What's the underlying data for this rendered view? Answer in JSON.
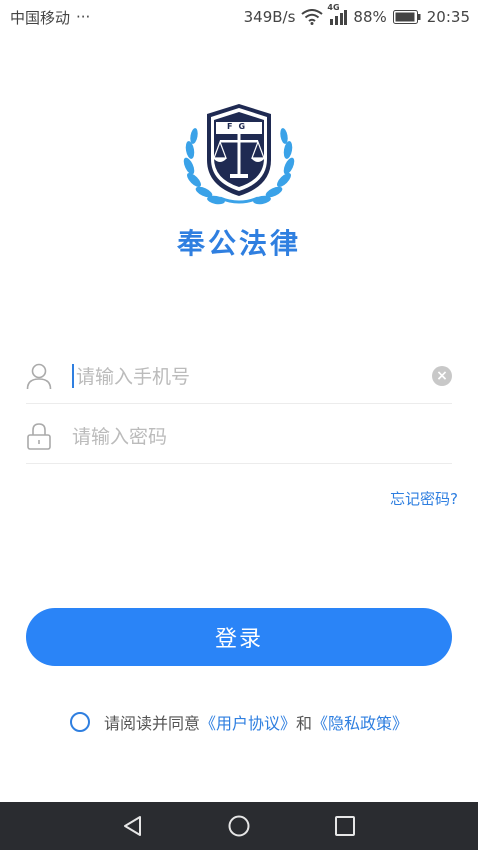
{
  "status_bar": {
    "carrier": "中国移动",
    "more": "···",
    "net_speed": "349B/s",
    "network_type": "4G",
    "battery": "88%",
    "time": "20:35"
  },
  "logo": {
    "badge_letters": "FG",
    "brand_name": "奉公法律",
    "brand_color": "#2f7fe0"
  },
  "login_form": {
    "phone_placeholder": "请输入手机号",
    "password_placeholder": "请输入密码",
    "forgot_password": "忘记密码?",
    "login_button": "登录"
  },
  "agreement": {
    "prefix": "请阅读并同意",
    "user_agreement": "《用户协议》",
    "conjunction": "和",
    "privacy_policy": "《隐私政策》"
  },
  "colors": {
    "accent": "#2a84f7",
    "navbar_bg": "#2a2c30"
  },
  "icons": {
    "user": "user-icon",
    "lock": "lock-icon",
    "clear": "clear-icon",
    "nav_back": "back-triangle-icon",
    "nav_home": "home-circle-icon",
    "nav_recent": "recent-square-icon"
  }
}
